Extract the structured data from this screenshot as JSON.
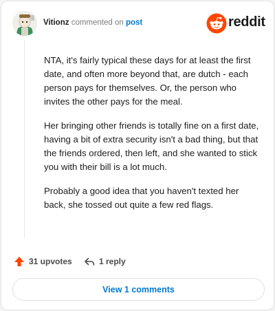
{
  "comment": {
    "author": "Vitionz",
    "action_text": "commented on",
    "post_link": "post",
    "body": [
      "NTA, it's fairly typical these days for at least the first date, and often more beyond that, are dutch - each person pays for themselves. Or, the person who invites the other pays for the meal.",
      "Her bringing other friends is totally fine on a first date, having a bit of extra security isn't a bad thing, but that the friends ordered, then left, and she wanted to stick you with their bill is a lot much.",
      "Probably a good idea that you haven't texted her back, she tossed out quite a few red flags."
    ]
  },
  "brand": {
    "name": "reddit",
    "color": "#ff4500"
  },
  "actions": {
    "upvotes": "31 upvotes",
    "replies": "1 reply",
    "upvote_icon": "upvote-arrow-icon",
    "reply_icon": "reply-arrow-icon"
  },
  "view_comments_label": "View 1 comments",
  "colors": {
    "accent": "#0079d3",
    "upvote": "#ff4500"
  }
}
